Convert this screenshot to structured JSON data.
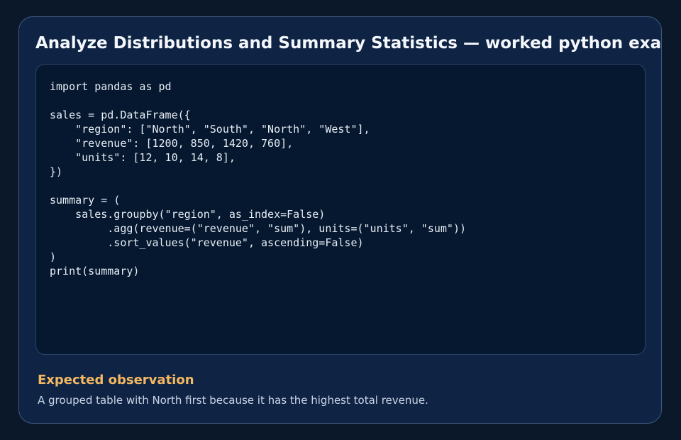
{
  "card": {
    "title": "Analyze Distributions and Summary Statistics — worked python example",
    "code": "import pandas as pd\n\nsales = pd.DataFrame({\n    \"region\": [\"North\", \"South\", \"North\", \"West\"],\n    \"revenue\": [1200, 850, 1420, 760],\n    \"units\": [12, 10, 14, 8],\n})\n\nsummary = (\n    sales.groupby(\"region\", as_index=False)\n         .agg(revenue=(\"revenue\", \"sum\"), units=(\"units\", \"sum\"))\n         .sort_values(\"revenue\", ascending=False)\n)\nprint(summary)",
    "observation": {
      "heading": "Expected observation",
      "text": "A grouped table with North first because it has the highest total revenue."
    }
  },
  "colors": {
    "background": "#0b1829",
    "card": "#0f2444",
    "card_border": "#3d5a80",
    "code_background": "#06182f",
    "title": "#f4f7fb",
    "accent": "#f5b862",
    "body_text": "#c9d5e6"
  }
}
